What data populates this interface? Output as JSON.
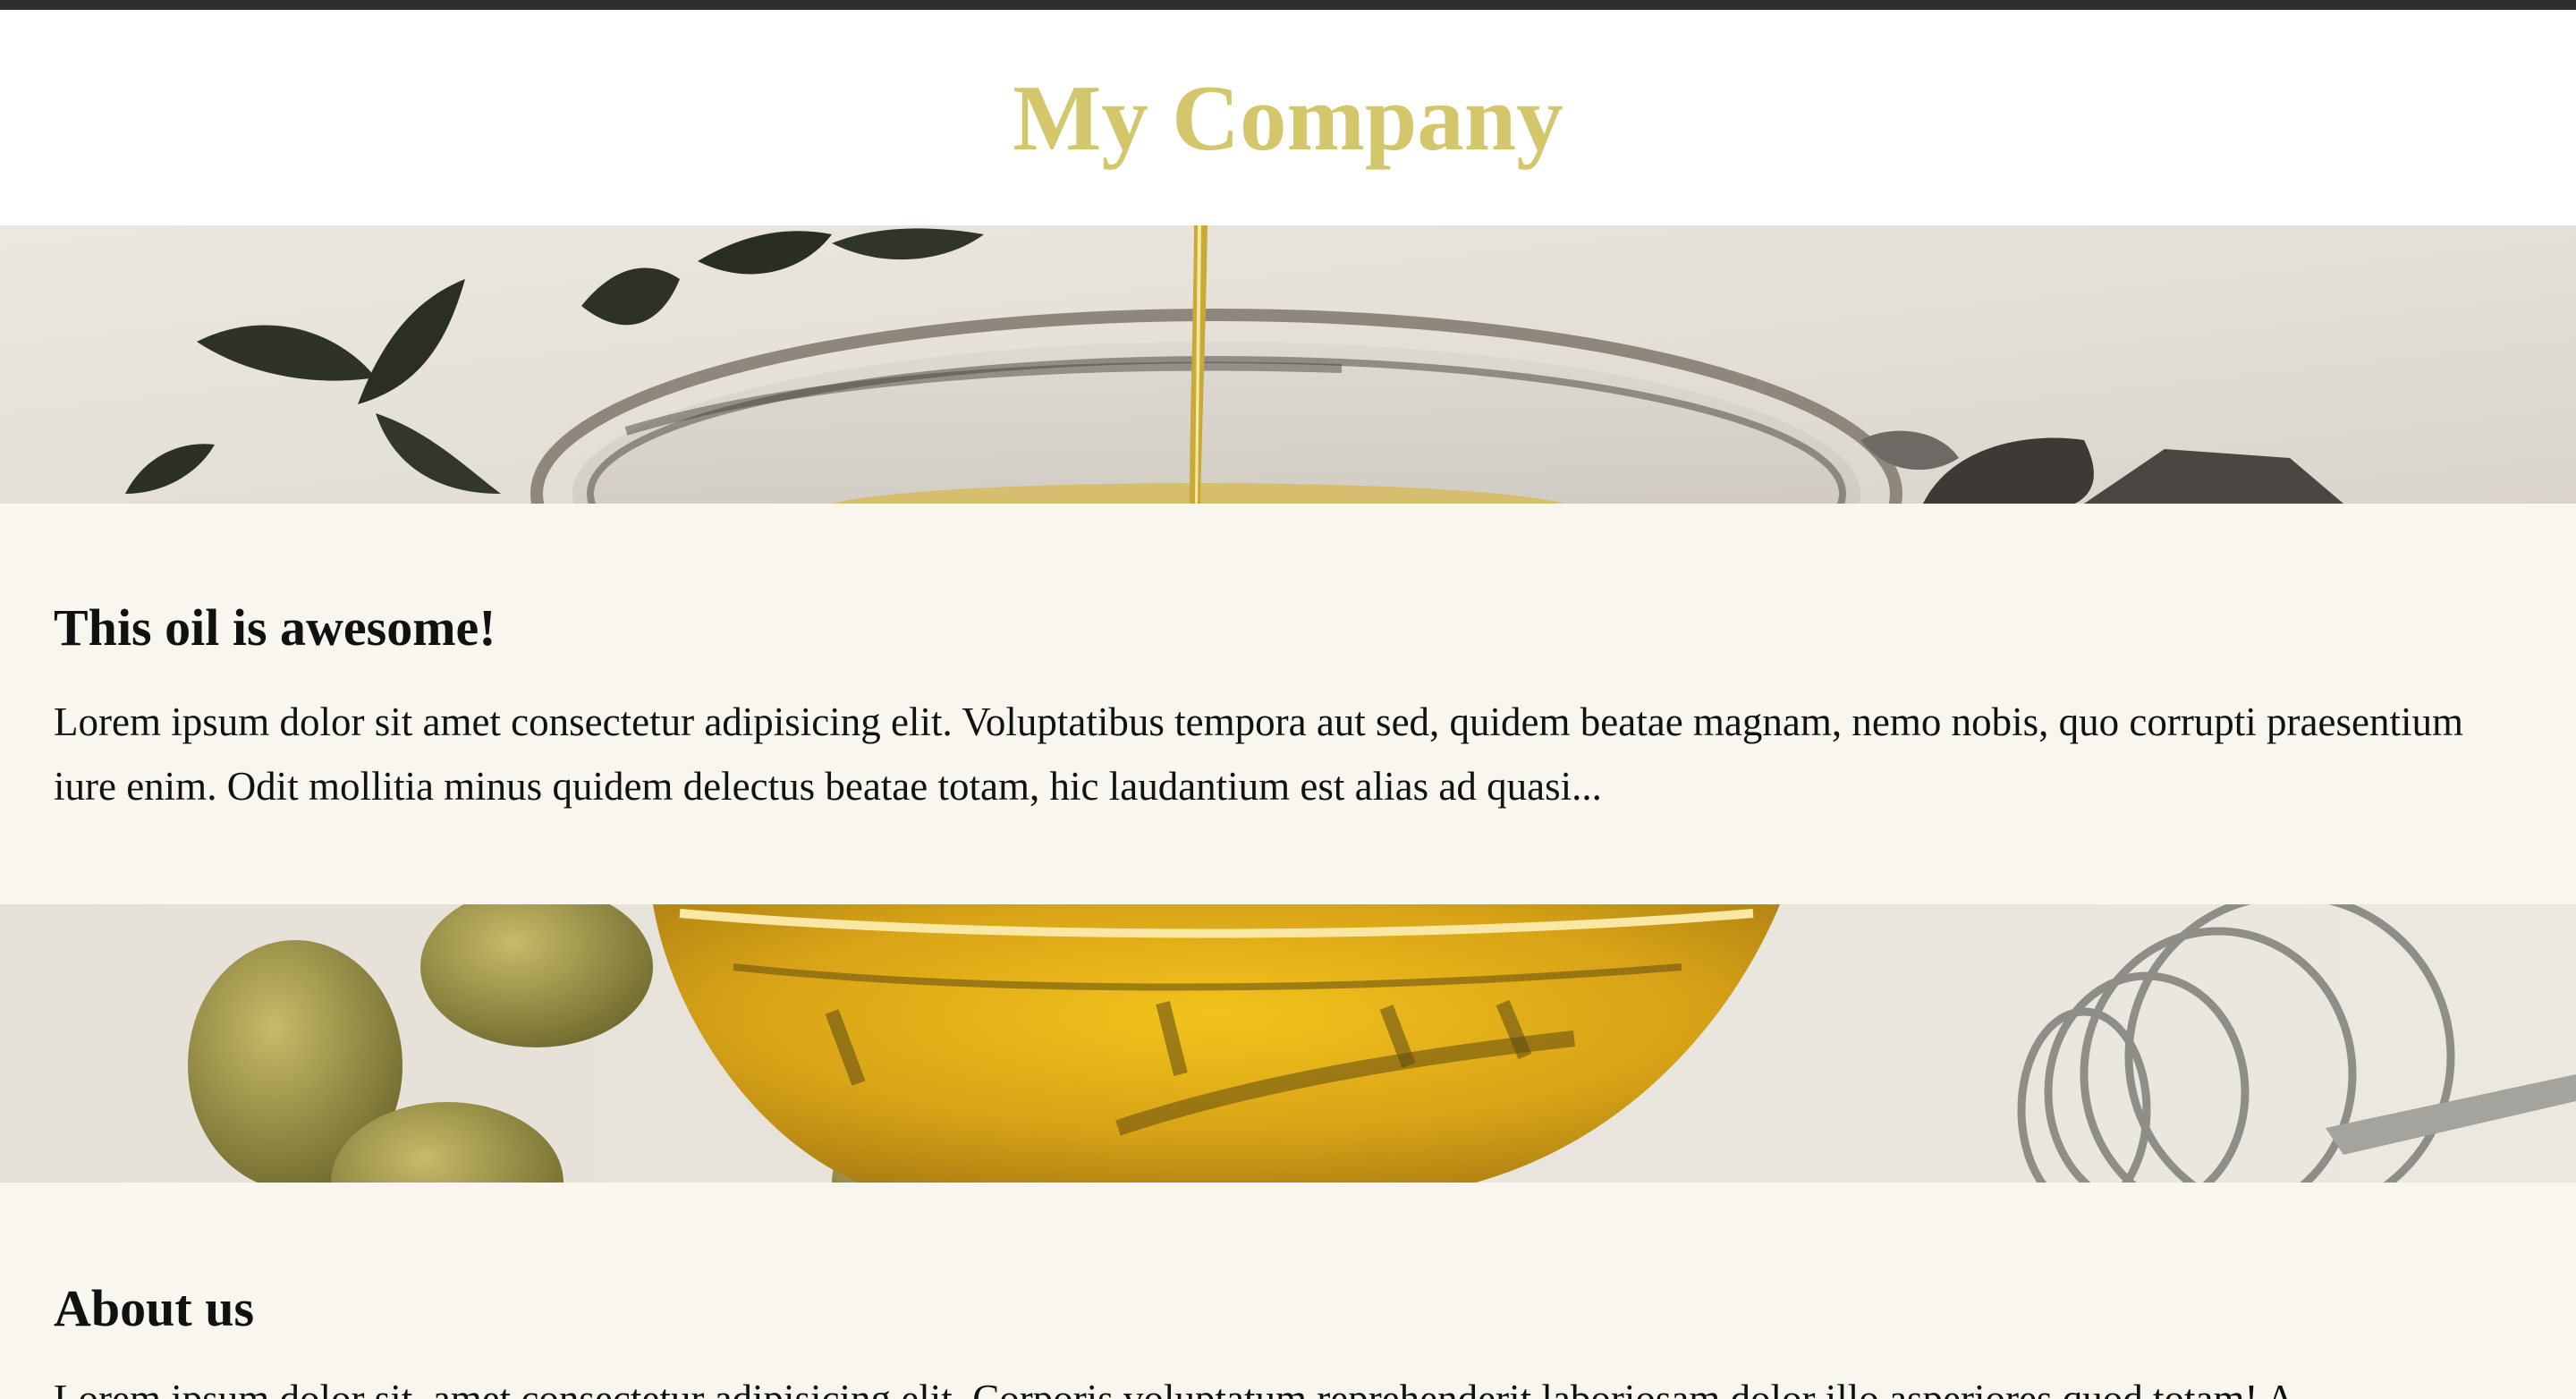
{
  "header": {
    "brand": "My Company"
  },
  "hero_images": [
    {
      "alt": "olive oil pouring into glass bowl"
    },
    {
      "alt": "bowl of olive oil with olives and whisk"
    }
  ],
  "sections": [
    {
      "heading": "This oil is awesome!",
      "body": "Lorem ipsum dolor sit amet consectetur adipisicing elit. Voluptatibus tempora aut sed, quidem beatae magnam, nemo nobis, quo corrupti praesentium iure enim. Odit mollitia minus quidem delectus beatae totam, hic laudantium est alias ad quasi..."
    },
    {
      "heading": "About us",
      "body": "Lorem ipsum dolor sit, amet consectetur adipisicing elit. Corporis voluptatum reprehenderit laboriosam dolor illo asperiores quod totam! A"
    }
  ],
  "colors": {
    "top_bar": "#2e2e2e",
    "brand": "#d4c66a",
    "section_background": "#f8f6ef",
    "text": "#111111"
  }
}
